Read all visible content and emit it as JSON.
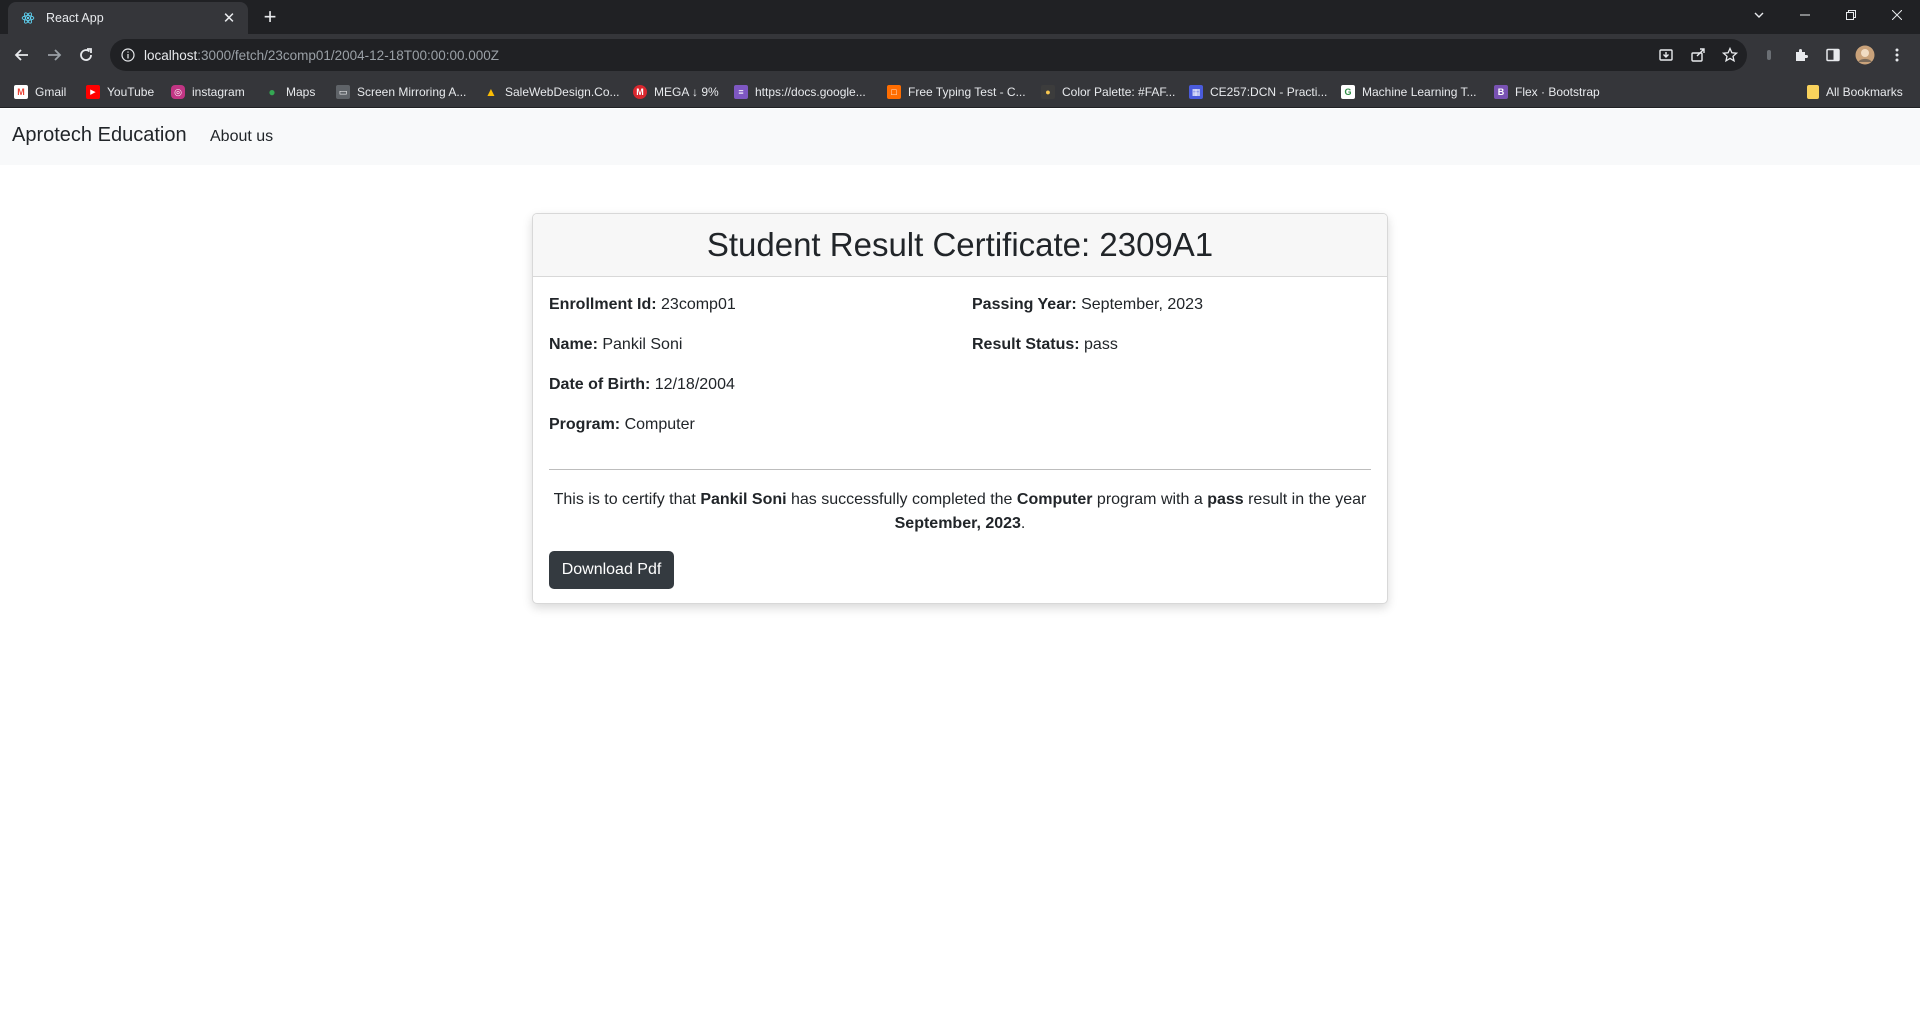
{
  "browser": {
    "tab_title": "React App",
    "url_host": "localhost",
    "url_path": ":3000/fetch/23comp01/2004-12-18T00:00:00.000Z",
    "bookmarks": [
      {
        "label": "Gmail",
        "icon": "gmail-icon",
        "color": "#ea4335",
        "glyph": "M"
      },
      {
        "label": "YouTube",
        "icon": "youtube-icon",
        "color": "#ff0000",
        "glyph": "▶"
      },
      {
        "label": "instagram",
        "icon": "instagram-icon",
        "color": "#c13584",
        "glyph": "◎"
      },
      {
        "label": "Maps",
        "icon": "maps-icon",
        "color": "#34a853",
        "glyph": "●"
      },
      {
        "label": "Screen Mirroring A...",
        "icon": "screen-mirroring-icon",
        "color": "#5f6368",
        "glyph": "▭"
      },
      {
        "label": "SaleWebDesign.Co...",
        "icon": "drive-icon",
        "color": "#fbbc04",
        "glyph": "▲"
      },
      {
        "label": "MEGA ↓ 9%",
        "icon": "mega-icon",
        "color": "#d9272e",
        "glyph": "M"
      },
      {
        "label": "https://docs.google...",
        "icon": "docs-icon",
        "color": "#7e57c2",
        "glyph": "≡"
      },
      {
        "label": "Free Typing Test - C...",
        "icon": "typing-icon",
        "color": "#ff6d00",
        "glyph": "□"
      },
      {
        "label": "Color Palette: #FAF...",
        "icon": "palette-icon",
        "color": "#3c3c3c",
        "glyph": "●"
      },
      {
        "label": "CE257:DCN - Practi...",
        "icon": "classroom-icon",
        "color": "#4a5bdc",
        "glyph": "▦"
      },
      {
        "label": "Machine Learning T...",
        "icon": "gfg-icon",
        "color": "#ffffff",
        "glyph": "G"
      },
      {
        "label": "Flex · Bootstrap",
        "icon": "bootstrap-icon",
        "color": "#7952b3",
        "glyph": "B"
      }
    ],
    "all_bookmarks": "All Bookmarks"
  },
  "navbar": {
    "brand": "Aprotech Education",
    "about": "About us"
  },
  "certificate": {
    "title": "Student Result Certificate: 2309A1",
    "enrollment_label": "Enrollment Id:",
    "enrollment_value": "23comp01",
    "name_label": "Name:",
    "name_value": "Pankil Soni",
    "dob_label": "Date of Birth:",
    "dob_value": "12/18/2004",
    "program_label": "Program:",
    "program_value": "Computer",
    "passing_label": "Passing Year:",
    "passing_value": "September, 2023",
    "status_label": "Result Status:",
    "status_value": "pass",
    "text_1": "This is to certify that ",
    "text_name": "Pankil Soni",
    "text_2": " has successfully completed the ",
    "text_program": "Computer",
    "text_3": " program with a ",
    "text_status": "pass",
    "text_4": " result in the year ",
    "text_year": "September, 2023",
    "text_5": ".",
    "download_button": "Download Pdf"
  }
}
